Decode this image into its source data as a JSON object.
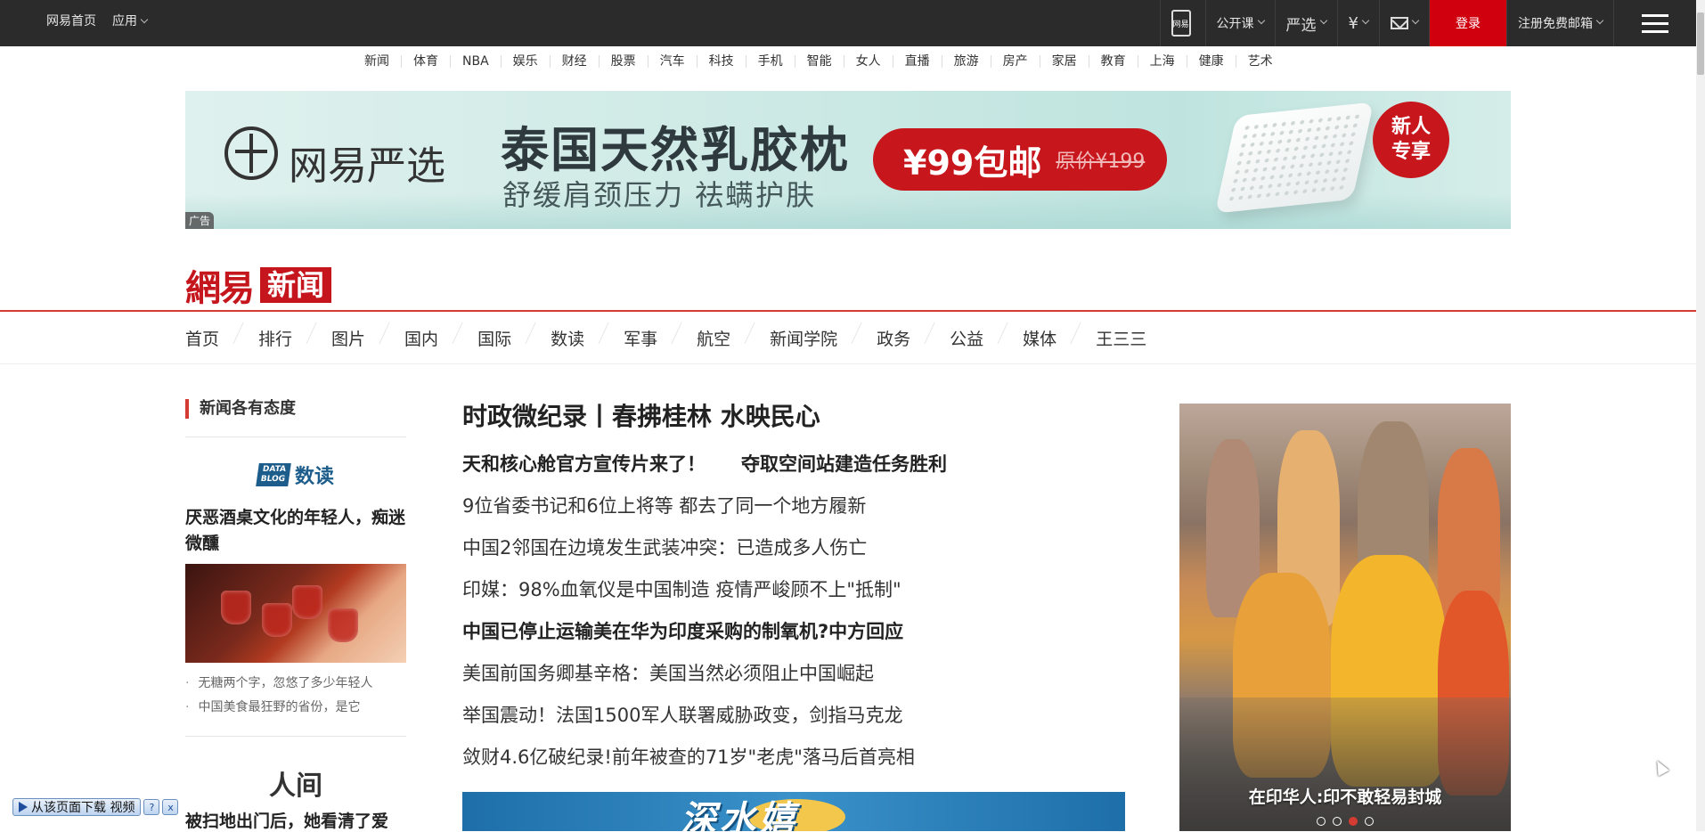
{
  "topbar": {
    "left": [
      "网易首页",
      "应用"
    ],
    "phone_label": "网易",
    "open_course": "公开课",
    "yanxuan": "严选",
    "login": "登录",
    "register_mail": "注册免费邮箱",
    "colors": {
      "bg": "#2b2b2b",
      "login_bg": "#d0000f"
    }
  },
  "channels": [
    "新闻",
    "体育",
    "NBA",
    "娱乐",
    "财经",
    "股票",
    "汽车",
    "科技",
    "手机",
    "智能",
    "女人",
    "直播",
    "旅游",
    "房产",
    "家居",
    "教育",
    "上海",
    "健康",
    "艺术"
  ],
  "banner": {
    "brand": "网易严选",
    "title": "泰国天然乳胶枕",
    "subtitle": "舒缓肩颈压力 祛螨护肤",
    "price": "¥99包邮",
    "old_price": "原价¥199",
    "badge_line1": "新人",
    "badge_line2": "专享",
    "ad_label": "广告"
  },
  "logo": {
    "part1": "網易",
    "part2": "新闻"
  },
  "main_nav": [
    "首页",
    "排行",
    "图片",
    "国内",
    "国际",
    "数读",
    "军事",
    "航空",
    "新闻学院",
    "政务",
    "公益",
    "媒体",
    "王三三"
  ],
  "left": {
    "heading": "新闻各有态度",
    "datablog_logo": "DATA BLOG",
    "datablog_text": "数读",
    "article_title": "厌恶酒桌文化的年轻人，痴迷微醺",
    "links": [
      "无糖两个字，忽悠了多少年轻人",
      "中国美食最狂野的省份，是它"
    ],
    "renjian": "人间",
    "article2_title": "被扫地出门后，她看清了爱"
  },
  "center": {
    "headline": "时政微纪录丨春拂桂林 水映民心",
    "bold_pair": [
      "天和核心舱官方宣传片来了！",
      "夺取空间站建造任务胜利"
    ],
    "items": [
      {
        "text": "9位省委书记和6位上将等 都去了同一个地方履新",
        "bold": false
      },
      {
        "text": "中国2邻国在边境发生武装冲突：已造成多人伤亡",
        "bold": false
      },
      {
        "text": "印媒：98%血氧仪是中国制造 疫情严峻顾不上\"抵制\"",
        "bold": false
      },
      {
        "text": "中国已停止运输美在华为印度采购的制氧机?中方回应",
        "bold": true
      },
      {
        "text": "美国前国务卿基辛格：美国当然必须阻止中国崛起",
        "bold": false
      },
      {
        "text": "举国震动！法国1500军人联署威胁政变，剑指马克龙",
        "bold": false
      },
      {
        "text": "敛财4.6亿破纪录!前年被查的71岁\"老虎\"落马后首亮相",
        "bold": false
      }
    ],
    "ad_text": "深水嬉"
  },
  "right": {
    "caption": "在印华人:印不敢轻易封城",
    "slides": 4,
    "active_slide": 3
  },
  "video_bar": {
    "label": "从该页面下载 视频",
    "help": "?",
    "close": "x"
  }
}
